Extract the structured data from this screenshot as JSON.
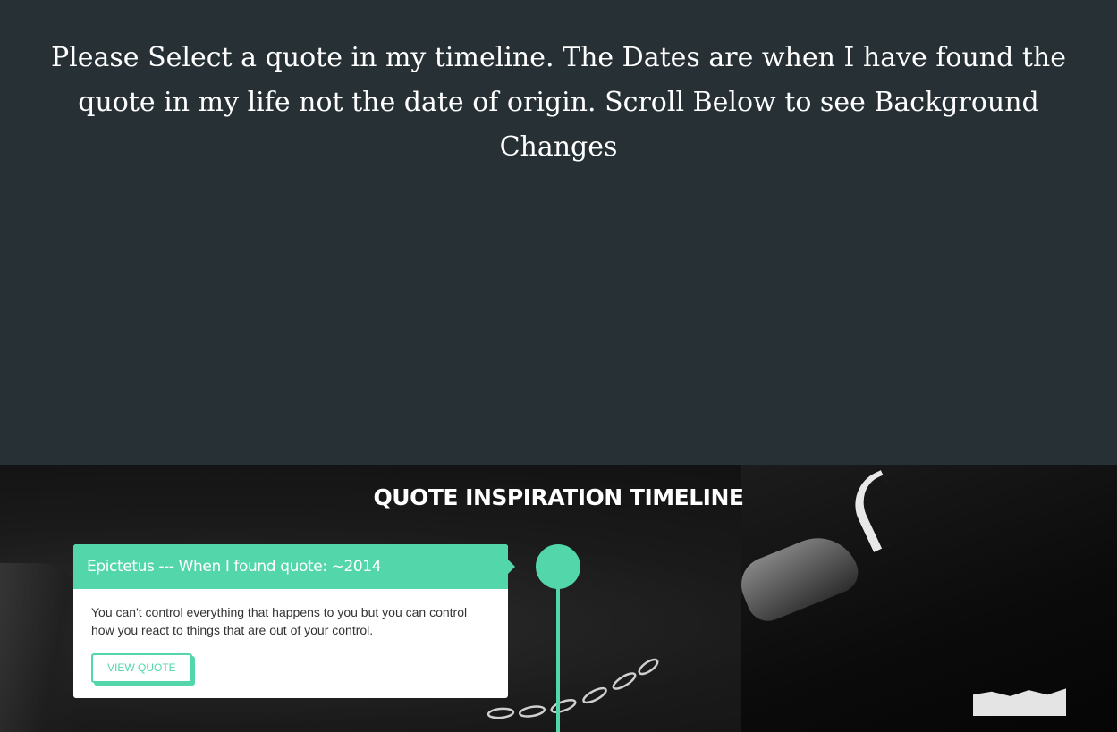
{
  "intro": {
    "text": "Please Select a quote in my timeline. The Dates are when I have found the quote in my life not the date of origin. Scroll Below to see Background Changes"
  },
  "timeline": {
    "title": "QUOTE INSPIRATION TIMELINE",
    "accent_color": "#52d6aa",
    "entries": [
      {
        "header": "Epictetus --- When I found quote: ~2014",
        "body": "You can't control everything that happens to you but you can control how you react to things that are out of your control.",
        "button_label": "VIEW QUOTE"
      }
    ]
  },
  "colors": {
    "intro_background": "#263035",
    "accent": "#52d6aa",
    "text_light": "#ffffff",
    "text_dark": "#333333"
  }
}
